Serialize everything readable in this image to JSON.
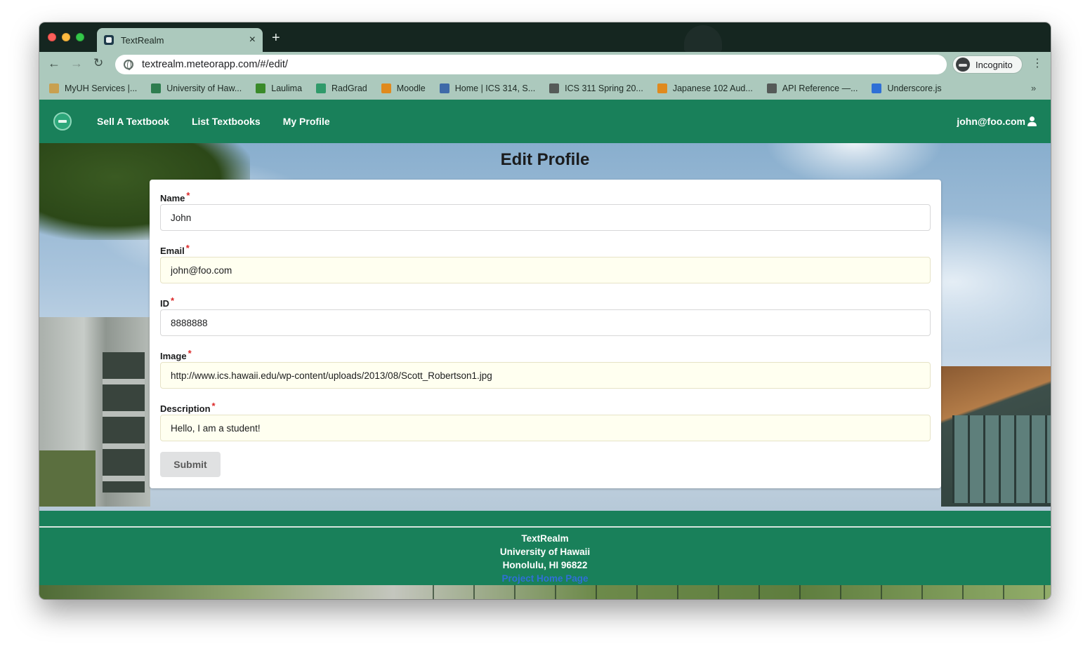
{
  "browser": {
    "tab_title": "TextRealm",
    "tab_close": "×",
    "new_tab": "+",
    "back": "←",
    "forward": "→",
    "reload": "↻",
    "url": "textrealm.meteorapp.com/#/edit/",
    "incognito_label": "Incognito",
    "menu": "⋮",
    "bookmarks_more": "»",
    "bookmarks": [
      {
        "label": "MyUH Services |...",
        "color": "#c8a050"
      },
      {
        "label": "University of Haw...",
        "color": "#2e7d4f"
      },
      {
        "label": "Laulima",
        "color": "#3a8a2a"
      },
      {
        "label": "RadGrad",
        "color": "#2f9a6a"
      },
      {
        "label": "Moodle",
        "color": "#e08a1e"
      },
      {
        "label": "Home | ICS 314, S...",
        "color": "#3f6aa8"
      },
      {
        "label": "ICS 311 Spring 20...",
        "color": "#555a58"
      },
      {
        "label": "Japanese 102 Aud...",
        "color": "#e08a1e"
      },
      {
        "label": "API Reference —...",
        "color": "#555a58"
      },
      {
        "label": "Underscore.js",
        "color": "#2f6fd6"
      }
    ]
  },
  "nav": {
    "links": [
      "Sell A Textbook",
      "List Textbooks",
      "My Profile"
    ],
    "user": "john@foo.com"
  },
  "page": {
    "title": "Edit Profile"
  },
  "form": {
    "required_mark": "*",
    "fields": [
      {
        "label": "Name",
        "value": "John"
      },
      {
        "label": "Email",
        "value": "john@foo.com"
      },
      {
        "label": "ID",
        "value": "8888888"
      },
      {
        "label": "Image",
        "value": "http://www.ics.hawaii.edu/wp-content/uploads/2013/08/Scott_Robertson1.jpg"
      },
      {
        "label": "Description",
        "value": "Hello, I am a student!"
      }
    ],
    "submit_label": "Submit"
  },
  "footer": {
    "lines": [
      "TextRealm",
      "University of Hawaii",
      "Honolulu, HI 96822"
    ],
    "link": "Project Home Page"
  },
  "colors": {
    "brand_green": "#19805a",
    "required_red": "#db2828",
    "link_blue": "#2f6fd6"
  }
}
